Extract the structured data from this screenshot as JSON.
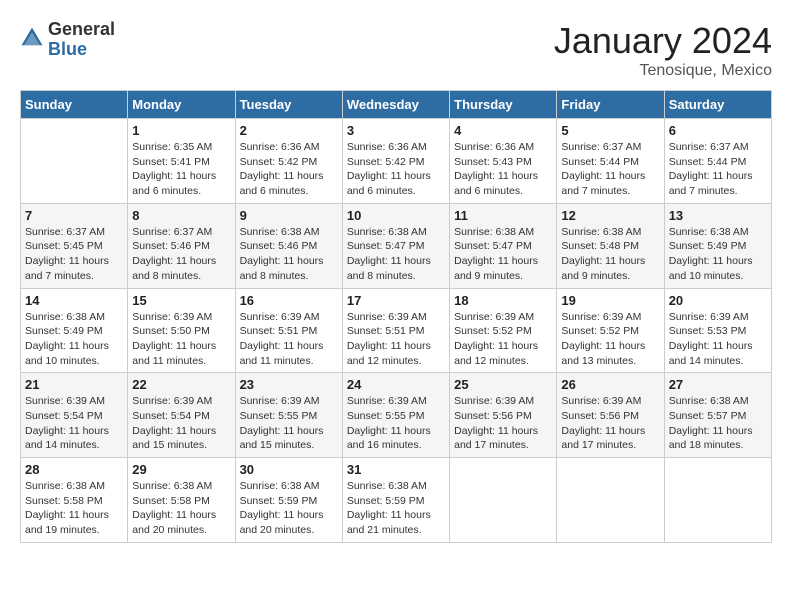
{
  "header": {
    "logo_general": "General",
    "logo_blue": "Blue",
    "title": "January 2024",
    "location": "Tenosique, Mexico"
  },
  "calendar": {
    "days_of_week": [
      "Sunday",
      "Monday",
      "Tuesday",
      "Wednesday",
      "Thursday",
      "Friday",
      "Saturday"
    ],
    "weeks": [
      [
        {
          "day": "",
          "info": ""
        },
        {
          "day": "1",
          "info": "Sunrise: 6:35 AM\nSunset: 5:41 PM\nDaylight: 11 hours and 6 minutes."
        },
        {
          "day": "2",
          "info": "Sunrise: 6:36 AM\nSunset: 5:42 PM\nDaylight: 11 hours and 6 minutes."
        },
        {
          "day": "3",
          "info": "Sunrise: 6:36 AM\nSunset: 5:42 PM\nDaylight: 11 hours and 6 minutes."
        },
        {
          "day": "4",
          "info": "Sunrise: 6:36 AM\nSunset: 5:43 PM\nDaylight: 11 hours and 6 minutes."
        },
        {
          "day": "5",
          "info": "Sunrise: 6:37 AM\nSunset: 5:44 PM\nDaylight: 11 hours and 7 minutes."
        },
        {
          "day": "6",
          "info": "Sunrise: 6:37 AM\nSunset: 5:44 PM\nDaylight: 11 hours and 7 minutes."
        }
      ],
      [
        {
          "day": "7",
          "info": "Sunrise: 6:37 AM\nSunset: 5:45 PM\nDaylight: 11 hours and 7 minutes."
        },
        {
          "day": "8",
          "info": "Sunrise: 6:37 AM\nSunset: 5:46 PM\nDaylight: 11 hours and 8 minutes."
        },
        {
          "day": "9",
          "info": "Sunrise: 6:38 AM\nSunset: 5:46 PM\nDaylight: 11 hours and 8 minutes."
        },
        {
          "day": "10",
          "info": "Sunrise: 6:38 AM\nSunset: 5:47 PM\nDaylight: 11 hours and 8 minutes."
        },
        {
          "day": "11",
          "info": "Sunrise: 6:38 AM\nSunset: 5:47 PM\nDaylight: 11 hours and 9 minutes."
        },
        {
          "day": "12",
          "info": "Sunrise: 6:38 AM\nSunset: 5:48 PM\nDaylight: 11 hours and 9 minutes."
        },
        {
          "day": "13",
          "info": "Sunrise: 6:38 AM\nSunset: 5:49 PM\nDaylight: 11 hours and 10 minutes."
        }
      ],
      [
        {
          "day": "14",
          "info": "Sunrise: 6:38 AM\nSunset: 5:49 PM\nDaylight: 11 hours and 10 minutes."
        },
        {
          "day": "15",
          "info": "Sunrise: 6:39 AM\nSunset: 5:50 PM\nDaylight: 11 hours and 11 minutes."
        },
        {
          "day": "16",
          "info": "Sunrise: 6:39 AM\nSunset: 5:51 PM\nDaylight: 11 hours and 11 minutes."
        },
        {
          "day": "17",
          "info": "Sunrise: 6:39 AM\nSunset: 5:51 PM\nDaylight: 11 hours and 12 minutes."
        },
        {
          "day": "18",
          "info": "Sunrise: 6:39 AM\nSunset: 5:52 PM\nDaylight: 11 hours and 12 minutes."
        },
        {
          "day": "19",
          "info": "Sunrise: 6:39 AM\nSunset: 5:52 PM\nDaylight: 11 hours and 13 minutes."
        },
        {
          "day": "20",
          "info": "Sunrise: 6:39 AM\nSunset: 5:53 PM\nDaylight: 11 hours and 14 minutes."
        }
      ],
      [
        {
          "day": "21",
          "info": "Sunrise: 6:39 AM\nSunset: 5:54 PM\nDaylight: 11 hours and 14 minutes."
        },
        {
          "day": "22",
          "info": "Sunrise: 6:39 AM\nSunset: 5:54 PM\nDaylight: 11 hours and 15 minutes."
        },
        {
          "day": "23",
          "info": "Sunrise: 6:39 AM\nSunset: 5:55 PM\nDaylight: 11 hours and 15 minutes."
        },
        {
          "day": "24",
          "info": "Sunrise: 6:39 AM\nSunset: 5:55 PM\nDaylight: 11 hours and 16 minutes."
        },
        {
          "day": "25",
          "info": "Sunrise: 6:39 AM\nSunset: 5:56 PM\nDaylight: 11 hours and 17 minutes."
        },
        {
          "day": "26",
          "info": "Sunrise: 6:39 AM\nSunset: 5:56 PM\nDaylight: 11 hours and 17 minutes."
        },
        {
          "day": "27",
          "info": "Sunrise: 6:38 AM\nSunset: 5:57 PM\nDaylight: 11 hours and 18 minutes."
        }
      ],
      [
        {
          "day": "28",
          "info": "Sunrise: 6:38 AM\nSunset: 5:58 PM\nDaylight: 11 hours and 19 minutes."
        },
        {
          "day": "29",
          "info": "Sunrise: 6:38 AM\nSunset: 5:58 PM\nDaylight: 11 hours and 20 minutes."
        },
        {
          "day": "30",
          "info": "Sunrise: 6:38 AM\nSunset: 5:59 PM\nDaylight: 11 hours and 20 minutes."
        },
        {
          "day": "31",
          "info": "Sunrise: 6:38 AM\nSunset: 5:59 PM\nDaylight: 11 hours and 21 minutes."
        },
        {
          "day": "",
          "info": ""
        },
        {
          "day": "",
          "info": ""
        },
        {
          "day": "",
          "info": ""
        }
      ]
    ]
  }
}
